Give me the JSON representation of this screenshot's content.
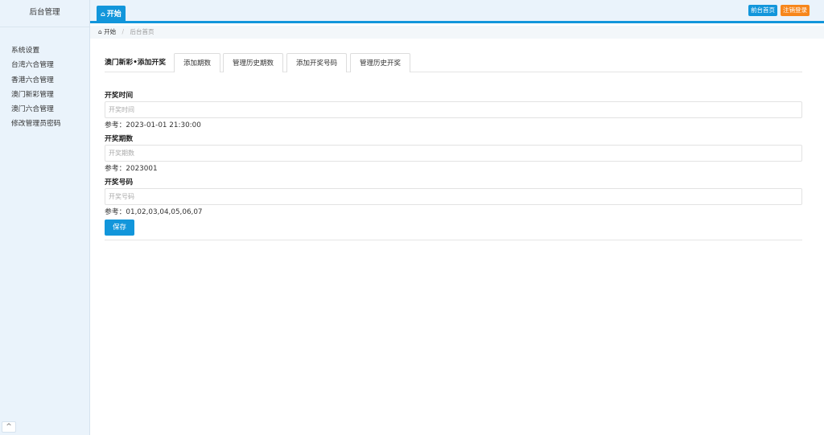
{
  "sidebar": {
    "brand": "后台管理",
    "items": [
      {
        "label": "系统设置"
      },
      {
        "label": "台湾六合管理"
      },
      {
        "label": "香港六合管理"
      },
      {
        "label": "澳门新彩管理"
      },
      {
        "label": "澳门六合管理"
      },
      {
        "label": "修改管理员密码"
      }
    ],
    "collapse_icon": "^"
  },
  "header": {
    "tab_label": "开始",
    "tab_icon": "home-icon",
    "front_button": "前台首页",
    "logout_button": "注销登录"
  },
  "breadcrumb": {
    "home": "开始",
    "separator": "/",
    "current": "后台首页"
  },
  "main": {
    "title": "澳门新彩•添加开奖",
    "tabs": [
      {
        "label": "添加期数"
      },
      {
        "label": "管理历史期数"
      },
      {
        "label": "添加开奖号码"
      },
      {
        "label": "管理历史开奖"
      }
    ],
    "form": {
      "time_label": "开奖时间",
      "time_placeholder": "开奖时间",
      "time_hint": "参考：2023-01-01 21:30:00",
      "period_label": "开奖期数",
      "period_placeholder": "开奖期数",
      "period_hint": "参考：2023001",
      "number_label": "开奖号码",
      "number_placeholder": "开奖号码",
      "number_hint": "参考：01,02,03,04,05,06,07",
      "save_label": "保存"
    }
  },
  "colors": {
    "primary": "#1296db",
    "orange": "#f7861b",
    "sidebar_bg": "#eaf3fb"
  }
}
